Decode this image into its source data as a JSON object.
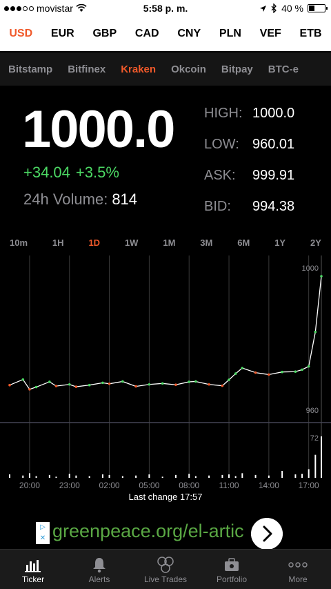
{
  "status": {
    "carrier": "movistar",
    "time": "5:58 p. m.",
    "battery": "40 %",
    "battery_level": 0.4
  },
  "currencies": [
    {
      "label": "USD",
      "active": true
    },
    {
      "label": "EUR"
    },
    {
      "label": "GBP"
    },
    {
      "label": "CAD"
    },
    {
      "label": "CNY"
    },
    {
      "label": "PLN"
    },
    {
      "label": "VEF"
    },
    {
      "label": "ETB"
    }
  ],
  "exchanges": [
    {
      "label": "Bitstamp"
    },
    {
      "label": "Bitfinex"
    },
    {
      "label": "Kraken",
      "active": true
    },
    {
      "label": "Okcoin"
    },
    {
      "label": "Bitpay"
    },
    {
      "label": "BTC-e"
    }
  ],
  "ticker": {
    "price": "1000.0",
    "change_abs": "+34.04",
    "change_pct": "+3.5%",
    "volume_label": "24h Volume:",
    "volume": "814"
  },
  "stats": {
    "high_label": "HIGH:",
    "high": "1000.0",
    "low_label": "LOW:",
    "low": "960.01",
    "ask_label": "ASK:",
    "ask": "999.91",
    "bid_label": "BID:",
    "bid": "994.38"
  },
  "ranges": [
    {
      "label": "10m"
    },
    {
      "label": "1H"
    },
    {
      "label": "1D",
      "active": true
    },
    {
      "label": "1W"
    },
    {
      "label": "1M"
    },
    {
      "label": "3M"
    },
    {
      "label": "6M"
    },
    {
      "label": "1Y"
    },
    {
      "label": "2Y"
    }
  ],
  "chart_data": {
    "type": "line",
    "x": [
      "18:30",
      "19:30",
      "20:00",
      "20:30",
      "21:30",
      "22:00",
      "23:00",
      "23:30",
      "00:30",
      "01:30",
      "02:00",
      "03:00",
      "04:00",
      "05:00",
      "06:00",
      "07:00",
      "08:00",
      "08:30",
      "09:30",
      "10:30",
      "11:00",
      "11:30",
      "12:00",
      "13:00",
      "14:00",
      "15:00",
      "16:00",
      "16:30",
      "17:00",
      "17:30",
      "17:57"
    ],
    "y": [
      966.8,
      968.5,
      965.5,
      966.2,
      967.8,
      966.5,
      967.0,
      966.3,
      966.8,
      967.5,
      967.2,
      967.9,
      966.4,
      967.0,
      967.3,
      966.9,
      967.8,
      967.9,
      967.0,
      966.6,
      968.4,
      970.3,
      972.0,
      970.6,
      970.0,
      970.8,
      970.9,
      971.5,
      972.5,
      983.0,
      1000.0
    ],
    "xticks": [
      "20:00",
      "23:00",
      "02:00",
      "05:00",
      "08:00",
      "11:00",
      "14:00",
      "17:00"
    ],
    "ylabels": [
      "1000",
      "960"
    ],
    "ylim": [
      960,
      1000
    ],
    "volume_label": "72",
    "volume_max": 72,
    "volume": [
      6,
      4,
      8,
      3,
      5,
      2,
      7,
      4,
      3,
      6,
      5,
      3,
      4,
      6,
      2,
      5,
      7,
      3,
      4,
      5,
      6,
      3,
      8,
      5,
      4,
      12,
      6,
      7,
      15,
      40,
      72
    ]
  },
  "last_change": "Last change 17:57",
  "ad": {
    "url_text": "greenpeace.org/el-artic"
  },
  "tabs": [
    {
      "label": "Ticker",
      "icon": "bar-chart-icon",
      "active": true
    },
    {
      "label": "Alerts",
      "icon": "bell-icon"
    },
    {
      "label": "Live Trades",
      "icon": "coins-icon"
    },
    {
      "label": "Portfolio",
      "icon": "briefcase-icon"
    },
    {
      "label": "More",
      "icon": "more-dots-icon"
    }
  ]
}
